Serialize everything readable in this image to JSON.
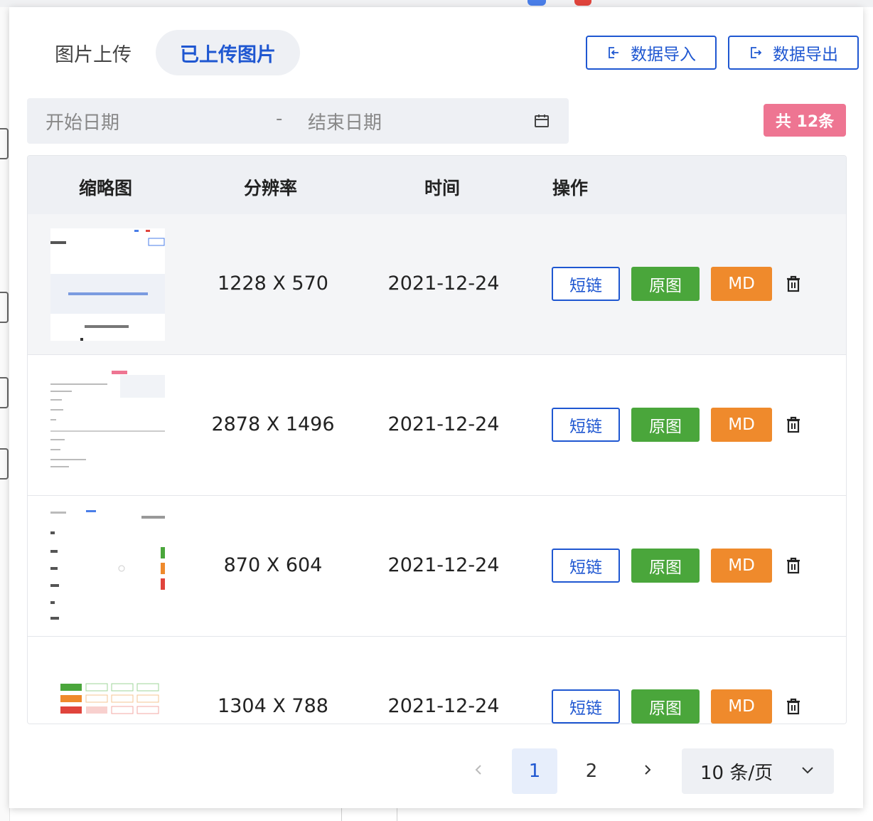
{
  "tabs": [
    {
      "label": "图片上传",
      "active": false
    },
    {
      "label": "已上传图片",
      "active": true
    }
  ],
  "toolbar": {
    "import_label": "数据导入",
    "export_label": "数据导出"
  },
  "filter": {
    "start_placeholder": "开始日期",
    "separator": "-",
    "end_placeholder": "结束日期",
    "calendar_icon": "calendar-icon"
  },
  "total_badge": "共 12条",
  "table": {
    "columns": [
      "缩略图",
      "分辨率",
      "时间",
      "操作"
    ],
    "rows": [
      {
        "resolution": "1228 X 570",
        "time": "2021-12-24",
        "highlighted": true
      },
      {
        "resolution": "2878 X 1496",
        "time": "2021-12-24",
        "highlighted": false
      },
      {
        "resolution": "870 X 604",
        "time": "2021-12-24",
        "highlighted": false
      },
      {
        "resolution": "1304 X 788",
        "time": "2021-12-24",
        "highlighted": false
      }
    ],
    "actions": {
      "short_link": "短链",
      "original": "原图",
      "markdown": "MD",
      "delete_icon": "trash-icon"
    }
  },
  "pagination": {
    "pages": [
      "1",
      "2"
    ],
    "current": "1",
    "page_size": "10 条/页"
  },
  "colors": {
    "primary": "#1f57d1",
    "success": "#4aa63b",
    "warning": "#ef8a2c",
    "badge": "#ee7592"
  }
}
